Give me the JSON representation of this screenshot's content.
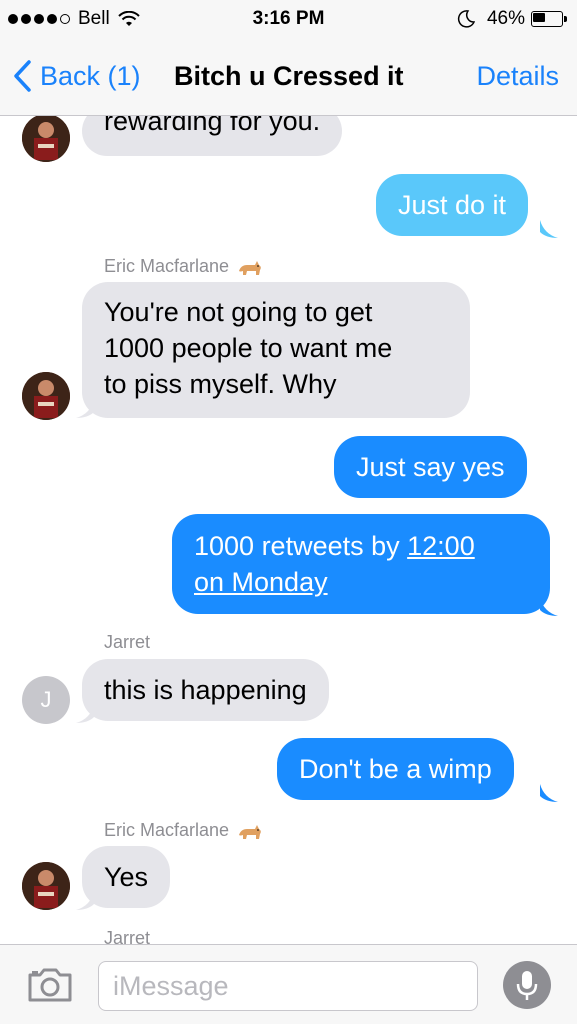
{
  "status_bar": {
    "carrier": "Bell",
    "time": "3:16 PM",
    "battery_percent": "46%",
    "battery_level": 0.46,
    "signal_bars_filled": 4,
    "signal_bars_total": 5
  },
  "nav": {
    "back_label": "Back (1)",
    "title": "Bitch u Cressed it",
    "details_label": "Details"
  },
  "messages": [
    {
      "direction": "in",
      "text": "rewarding for you."
    },
    {
      "direction": "out",
      "text": "Just do it"
    },
    {
      "sender": "Eric Macfarlane"
    },
    {
      "direction": "in",
      "lines": [
        "You're not going to get",
        "1000 people to want me",
        "to piss myself. Why"
      ]
    },
    {
      "direction": "out",
      "text": "Just say yes"
    },
    {
      "direction": "out",
      "lines": [
        "1000 retweets by ",
        "12:00",
        "on Monday"
      ]
    },
    {
      "sender": "Jarret",
      "avatar_letter": "J"
    },
    {
      "direction": "in",
      "text": "this is happening"
    },
    {
      "direction": "out",
      "text": "Don't be a wimp"
    },
    {
      "sender": "Eric Macfarlane"
    },
    {
      "direction": "in",
      "text": "Yes"
    },
    {
      "sender": "Jarret"
    }
  ],
  "input": {
    "placeholder": "iMessage"
  },
  "colors": {
    "accent": "#1a82fb",
    "outgoing_bubble": "#1a8cff",
    "incoming_bubble": "#e5e5ea",
    "sender_label": "#8e8e93"
  },
  "icons": {
    "back": "chevron-left-icon",
    "wifi": "wifi-icon",
    "moon": "moon-icon",
    "battery": "battery-icon",
    "camera": "camera-icon",
    "mic": "microphone-icon",
    "sender_emoji": "cat-icon"
  }
}
